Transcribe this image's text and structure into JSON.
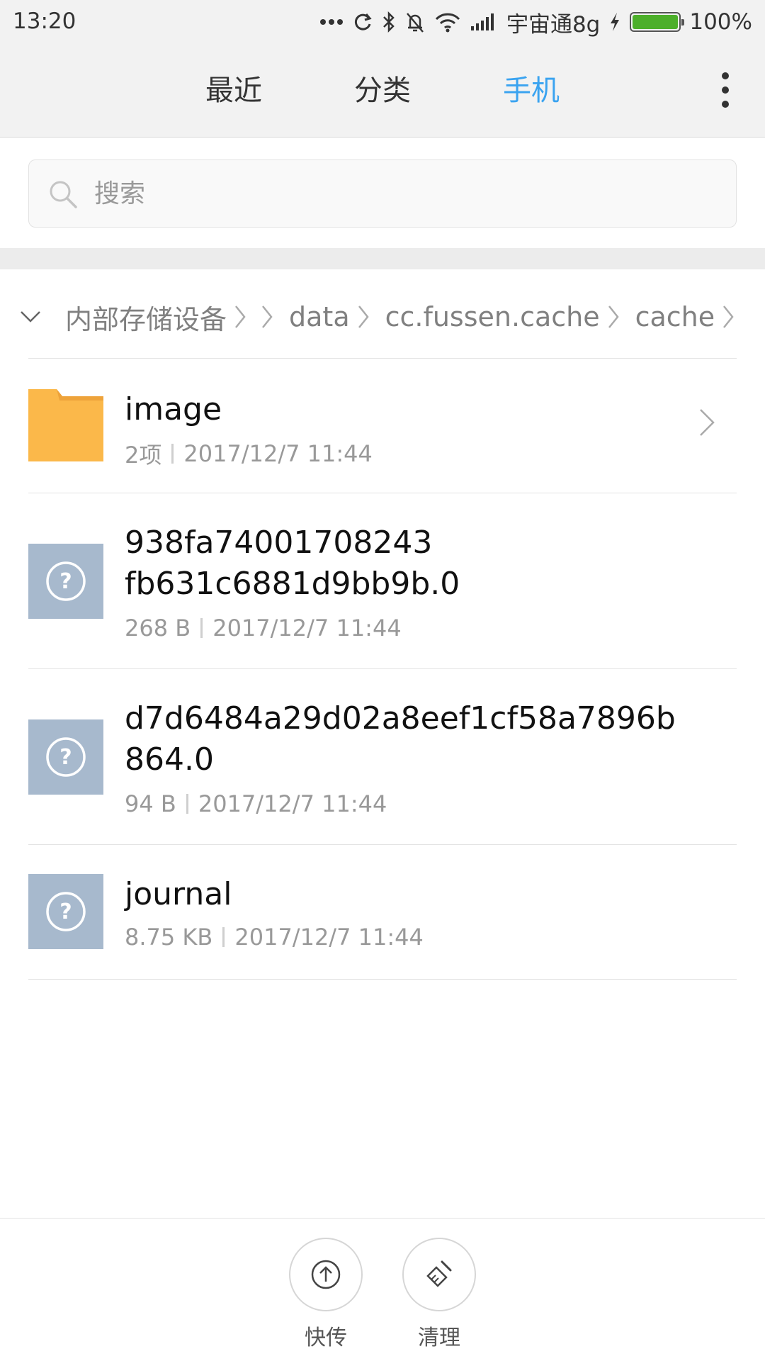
{
  "status_bar": {
    "time": "13:20",
    "carrier": "宇宙通8g",
    "battery": "100%",
    "battery_level": 1.0,
    "icons": [
      "more-dots-icon",
      "sync-icon",
      "bluetooth-icon",
      "mute-bell-icon",
      "wifi-icon",
      "signal-icon",
      "charging-icon"
    ]
  },
  "tabs": [
    {
      "label": "最近",
      "active": false
    },
    {
      "label": "分类",
      "active": false
    },
    {
      "label": "手机",
      "active": true
    }
  ],
  "colors": {
    "accent": "#3aa3f0",
    "folder": "#fbb84a",
    "unknown_file": "#a7b9cd",
    "battery": "#4caf2a"
  },
  "search": {
    "placeholder": "搜索"
  },
  "breadcrumb": [
    "内部存储设备",
    "data",
    "cc.fussen.cache",
    "cache"
  ],
  "files": [
    {
      "name": "image",
      "type": "folder",
      "size": "2项",
      "date": "2017/12/7 11:44"
    },
    {
      "name_line1": "938fa74001708243",
      "name_line2": "fb631c6881d9bb9b.0",
      "type": "unknown",
      "size": "268 B",
      "date": "2017/12/7 11:44"
    },
    {
      "name_line1": "d7d6484a29d02a8eef1cf58a7896b",
      "name_line2": "864.0",
      "type": "unknown",
      "size": "94 B",
      "date": "2017/12/7 11:44"
    },
    {
      "name": "journal",
      "type": "unknown",
      "size": "8.75 KB",
      "date": "2017/12/7 11:44"
    }
  ],
  "actions": [
    {
      "label": "快传",
      "icon": "upload-icon"
    },
    {
      "label": "清理",
      "icon": "broom-icon"
    }
  ]
}
